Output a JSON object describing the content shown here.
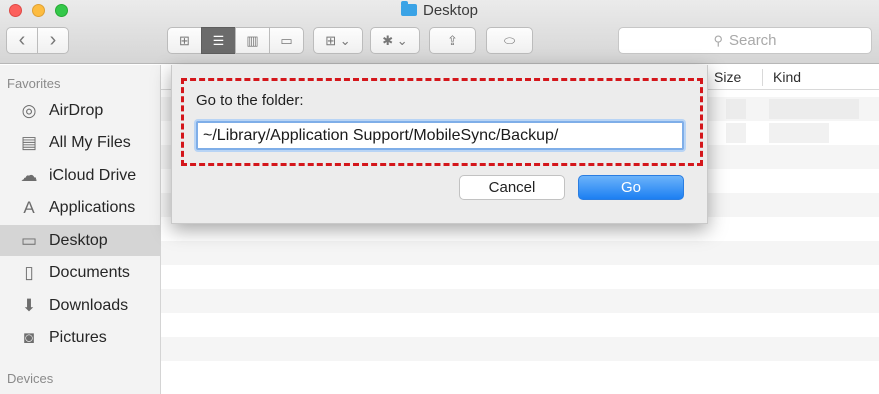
{
  "window": {
    "title": "Desktop",
    "title_icon": "folder-icon"
  },
  "toolbar": {
    "back_glyph": "‹",
    "forward_glyph": "›",
    "view_modes": [
      {
        "name": "icon-view",
        "glyph": "⊞",
        "active": false
      },
      {
        "name": "list-view",
        "glyph": "☰",
        "active": true
      },
      {
        "name": "column-view",
        "glyph": "▥",
        "active": false
      },
      {
        "name": "cover-flow-view",
        "glyph": "▭",
        "active": false
      }
    ],
    "arrange_glyph": "⊞ ⌄",
    "action_glyph": "✱ ⌄",
    "share_glyph": "⇪",
    "tag_glyph": "⬭",
    "search_placeholder": "Search",
    "search_icon": "⚲"
  },
  "sidebar": {
    "favorites_header": "Favorites",
    "devices_header": "Devices",
    "items": [
      {
        "label": "AirDrop",
        "icon": "airdrop-icon",
        "glyph": "◎",
        "selected": false
      },
      {
        "label": "All My Files",
        "icon": "all-files-icon",
        "glyph": "▤",
        "selected": false
      },
      {
        "label": "iCloud Drive",
        "icon": "cloud-icon",
        "glyph": "☁",
        "selected": false
      },
      {
        "label": "Applications",
        "icon": "applications-icon",
        "glyph": "A",
        "selected": false
      },
      {
        "label": "Desktop",
        "icon": "desktop-icon",
        "glyph": "▭",
        "selected": true
      },
      {
        "label": "Documents",
        "icon": "documents-icon",
        "glyph": "▯",
        "selected": false
      },
      {
        "label": "Downloads",
        "icon": "downloads-icon",
        "glyph": "⬇",
        "selected": false
      },
      {
        "label": "Pictures",
        "icon": "pictures-icon",
        "glyph": "◙",
        "selected": false
      }
    ]
  },
  "columns": {
    "size": "Size",
    "kind": "Kind"
  },
  "dialog": {
    "label": "Go to the folder:",
    "path_value": "~/Library/Application Support/MobileSync/Backup/",
    "cancel_label": "Cancel",
    "go_label": "Go",
    "highlight_color": "#d4161b",
    "go_color": "#1c7ff2"
  }
}
